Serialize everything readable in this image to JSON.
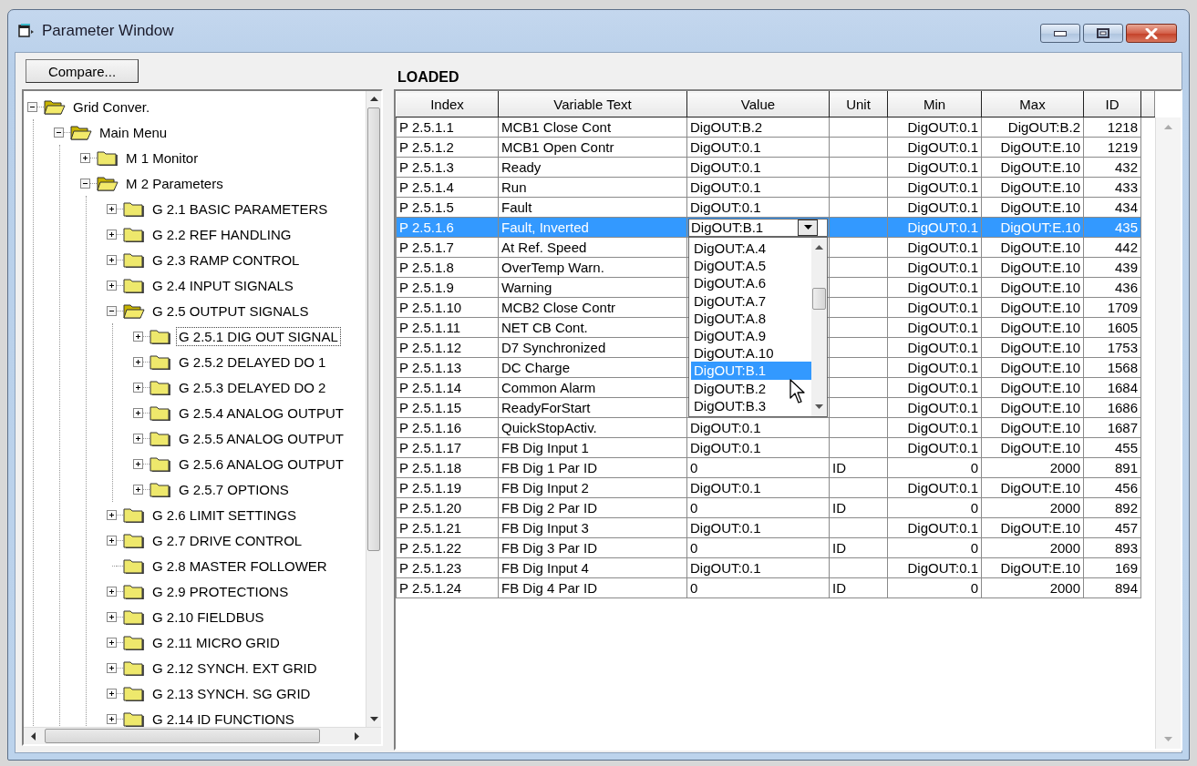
{
  "window": {
    "title": "Parameter Window"
  },
  "toolbar": {
    "compare_button": "Compare...",
    "status": "LOADED"
  },
  "tree": [
    {
      "label": "Grid Conver.",
      "expandable": true,
      "expanded": true,
      "selected": false,
      "children": [
        {
          "label": "Main Menu",
          "expandable": true,
          "expanded": true,
          "selected": false,
          "children": [
            {
              "label": "M 1 Monitor",
              "expandable": true,
              "expanded": false,
              "selected": false
            },
            {
              "label": "M 2 Parameters",
              "expandable": true,
              "expanded": true,
              "selected": false,
              "children": [
                {
                  "label": "G 2.1 BASIC PARAMETERS",
                  "expandable": true,
                  "expanded": false,
                  "selected": false
                },
                {
                  "label": "G 2.2 REF HANDLING",
                  "expandable": true,
                  "expanded": false,
                  "selected": false
                },
                {
                  "label": "G 2.3 RAMP CONTROL",
                  "expandable": true,
                  "expanded": false,
                  "selected": false
                },
                {
                  "label": "G 2.4 INPUT SIGNALS",
                  "expandable": true,
                  "expanded": false,
                  "selected": false
                },
                {
                  "label": "G 2.5 OUTPUT SIGNALS",
                  "expandable": true,
                  "expanded": true,
                  "selected": false,
                  "children": [
                    {
                      "label": "G 2.5.1 DIG OUT SIGNAL",
                      "expandable": true,
                      "expanded": false,
                      "selected": true
                    },
                    {
                      "label": "G 2.5.2 DELAYED DO 1",
                      "expandable": true,
                      "expanded": false,
                      "selected": false
                    },
                    {
                      "label": "G 2.5.3 DELAYED DO 2",
                      "expandable": true,
                      "expanded": false,
                      "selected": false
                    },
                    {
                      "label": "G 2.5.4 ANALOG OUTPUT",
                      "expandable": true,
                      "expanded": false,
                      "selected": false
                    },
                    {
                      "label": "G 2.5.5 ANALOG OUTPUT",
                      "expandable": true,
                      "expanded": false,
                      "selected": false
                    },
                    {
                      "label": "G 2.5.6 ANALOG OUTPUT",
                      "expandable": true,
                      "expanded": false,
                      "selected": false
                    },
                    {
                      "label": "G 2.5.7 OPTIONS",
                      "expandable": true,
                      "expanded": false,
                      "selected": false
                    }
                  ]
                },
                {
                  "label": "G 2.6 LIMIT SETTINGS",
                  "expandable": true,
                  "expanded": false,
                  "selected": false
                },
                {
                  "label": "G 2.7 DRIVE CONTROL",
                  "expandable": true,
                  "expanded": false,
                  "selected": false
                },
                {
                  "label": "G 2.8 MASTER FOLLOWER",
                  "expandable": false,
                  "expanded": false,
                  "selected": false
                },
                {
                  "label": "G 2.9 PROTECTIONS",
                  "expandable": true,
                  "expanded": false,
                  "selected": false
                },
                {
                  "label": "G 2.10 FIELDBUS",
                  "expandable": true,
                  "expanded": false,
                  "selected": false
                },
                {
                  "label": "G 2.11 MICRO GRID",
                  "expandable": true,
                  "expanded": false,
                  "selected": false
                },
                {
                  "label": "G 2.12 SYNCH. EXT GRID",
                  "expandable": true,
                  "expanded": false,
                  "selected": false
                },
                {
                  "label": "G 2.13 SYNCH. SG GRID",
                  "expandable": true,
                  "expanded": false,
                  "selected": false
                },
                {
                  "label": "G 2.14 ID FUNCTIONS",
                  "expandable": true,
                  "expanded": false,
                  "selected": false
                }
              ]
            }
          ]
        }
      ]
    }
  ],
  "table": {
    "columns": [
      "Index",
      "Variable Text",
      "Value",
      "Unit",
      "Min",
      "Max",
      "ID"
    ],
    "rows": [
      {
        "index": "P 2.5.1.1",
        "text": "MCB1 Close Cont",
        "value": "DigOUT:B.2",
        "min": "DigOUT:0.1",
        "max": "DigOUT:B.2",
        "id": "1218",
        "selected": false,
        "editing": false
      },
      {
        "index": "P 2.5.1.2",
        "text": "MCB1 Open Contr",
        "value": "DigOUT:0.1",
        "min": "DigOUT:0.1",
        "max": "DigOUT:E.10",
        "id": "1219",
        "selected": false,
        "editing": false
      },
      {
        "index": "P 2.5.1.3",
        "text": "Ready",
        "value": "DigOUT:0.1",
        "min": "DigOUT:0.1",
        "max": "DigOUT:E.10",
        "id": "432",
        "selected": false,
        "editing": false
      },
      {
        "index": "P 2.5.1.4",
        "text": "Run",
        "value": "DigOUT:0.1",
        "min": "DigOUT:0.1",
        "max": "DigOUT:E.10",
        "id": "433",
        "selected": false,
        "editing": false
      },
      {
        "index": "P 2.5.1.5",
        "text": "Fault",
        "value": "DigOUT:0.1",
        "min": "DigOUT:0.1",
        "max": "DigOUT:E.10",
        "id": "434",
        "selected": false,
        "editing": false
      },
      {
        "index": "P 2.5.1.6",
        "text": "Fault, Inverted",
        "value": "DigOUT:B.1",
        "min": "DigOUT:0.1",
        "max": "DigOUT:E.10",
        "id": "435",
        "selected": true,
        "editing": true
      },
      {
        "index": "P 2.5.1.7",
        "text": "At Ref. Speed",
        "min": "DigOUT:0.1",
        "max": "DigOUT:E.10",
        "id": "442",
        "selected": false,
        "editing": false
      },
      {
        "index": "P 2.5.1.8",
        "text": "OverTemp Warn.",
        "min": "DigOUT:0.1",
        "max": "DigOUT:E.10",
        "id": "439",
        "selected": false,
        "editing": false
      },
      {
        "index": "P 2.5.1.9",
        "text": "Warning",
        "min": "DigOUT:0.1",
        "max": "DigOUT:E.10",
        "id": "436",
        "selected": false,
        "editing": false
      },
      {
        "index": "P 2.5.1.10",
        "text": "MCB2 Close Contr",
        "min": "DigOUT:0.1",
        "max": "DigOUT:E.10",
        "id": "1709",
        "selected": false,
        "editing": false
      },
      {
        "index": "P 2.5.1.11",
        "text": "NET CB Cont.",
        "min": "DigOUT:0.1",
        "max": "DigOUT:E.10",
        "id": "1605",
        "selected": false,
        "editing": false
      },
      {
        "index": "P 2.5.1.12",
        "text": "D7 Synchronized",
        "min": "DigOUT:0.1",
        "max": "DigOUT:E.10",
        "id": "1753",
        "selected": false,
        "editing": false
      },
      {
        "index": "P 2.5.1.13",
        "text": "DC Charge",
        "min": "DigOUT:0.1",
        "max": "DigOUT:E.10",
        "id": "1568",
        "selected": false,
        "editing": false
      },
      {
        "index": "P 2.5.1.14",
        "text": "Common Alarm",
        "min": "DigOUT:0.1",
        "max": "DigOUT:E.10",
        "id": "1684",
        "selected": false,
        "editing": false
      },
      {
        "index": "P 2.5.1.15",
        "text": "ReadyForStart",
        "min": "DigOUT:0.1",
        "max": "DigOUT:E.10",
        "id": "1686",
        "selected": false,
        "editing": false
      },
      {
        "index": "P 2.5.1.16",
        "text": "QuickStopActiv.",
        "value": "DigOUT:0.1",
        "min": "DigOUT:0.1",
        "max": "DigOUT:E.10",
        "id": "1687",
        "selected": false,
        "editing": false
      },
      {
        "index": "P 2.5.1.17",
        "text": "FB Dig Input 1",
        "value": "DigOUT:0.1",
        "min": "DigOUT:0.1",
        "max": "DigOUT:E.10",
        "id": "455",
        "selected": false,
        "editing": false
      },
      {
        "index": "P 2.5.1.18",
        "text": "FB Dig 1 Par ID",
        "value": "0",
        "unit": "ID",
        "min": "0",
        "max": "2000",
        "id": "891",
        "selected": false,
        "editing": false
      },
      {
        "index": "P 2.5.1.19",
        "text": "FB Dig Input 2",
        "value": "DigOUT:0.1",
        "min": "DigOUT:0.1",
        "max": "DigOUT:E.10",
        "id": "456",
        "selected": false,
        "editing": false
      },
      {
        "index": "P 2.5.1.20",
        "text": "FB Dig 2 Par ID",
        "value": "0",
        "unit": "ID",
        "min": "0",
        "max": "2000",
        "id": "892",
        "selected": false,
        "editing": false
      },
      {
        "index": "P 2.5.1.21",
        "text": "FB Dig Input 3",
        "value": "DigOUT:0.1",
        "min": "DigOUT:0.1",
        "max": "DigOUT:E.10",
        "id": "457",
        "selected": false,
        "editing": false
      },
      {
        "index": "P 2.5.1.22",
        "text": "FB Dig 3 Par ID",
        "value": "0",
        "unit": "ID",
        "min": "0",
        "max": "2000",
        "id": "893",
        "selected": false,
        "editing": false
      },
      {
        "index": "P 2.5.1.23",
        "text": "FB Dig Input 4",
        "value": "DigOUT:0.1",
        "min": "DigOUT:0.1",
        "max": "DigOUT:E.10",
        "id": "169",
        "selected": false,
        "editing": false
      },
      {
        "index": "P 2.5.1.24",
        "text": "FB Dig 4 Par ID",
        "value": "0",
        "unit": "ID",
        "min": "0",
        "max": "2000",
        "id": "894",
        "selected": false,
        "editing": false
      }
    ],
    "value_options": [
      {
        "label": "DigOUT:A.4",
        "selected": false
      },
      {
        "label": "DigOUT:A.5",
        "selected": false
      },
      {
        "label": "DigOUT:A.6",
        "selected": false
      },
      {
        "label": "DigOUT:A.7",
        "selected": false
      },
      {
        "label": "DigOUT:A.8",
        "selected": false
      },
      {
        "label": "DigOUT:A.9",
        "selected": false
      },
      {
        "label": "DigOUT:A.10",
        "selected": false
      },
      {
        "label": "DigOUT:B.1",
        "selected": true
      },
      {
        "label": "DigOUT:B.2",
        "selected": false
      },
      {
        "label": "DigOUT:B.3",
        "selected": false
      }
    ]
  }
}
